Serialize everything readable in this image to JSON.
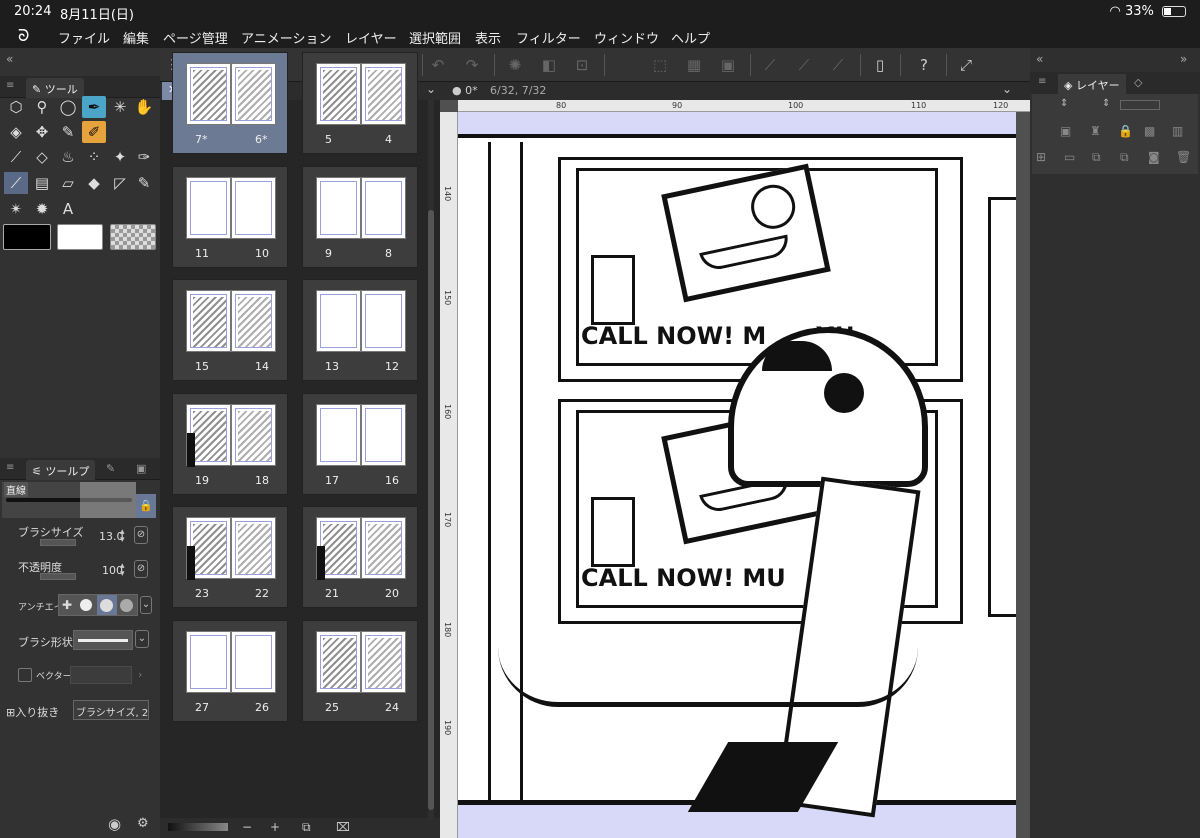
{
  "status": {
    "time": "20:24",
    "date": "8月11日(日)",
    "battery": "33%"
  },
  "menu": [
    "ファイル",
    "編集",
    "ページ管理",
    "アニメーション",
    "レイヤー",
    "選択範囲",
    "表示",
    "フィルター",
    "ウィンドウ",
    "ヘルプ"
  ],
  "toolbar": {
    "icons": [
      "menu-icon",
      "new-icon",
      "chevron-icon",
      "record-icon",
      "add-page-icon",
      "open-icon",
      "export-icon",
      "updown-icon",
      "undo-icon",
      "redo-icon",
      "loading-icon",
      "fill-icon",
      "transform-icon",
      "deselect-icon",
      "invert-icon",
      "border-icon",
      "pen-ruler-icon",
      "brush-ruler-icon",
      "line-ruler-icon",
      "device-icon",
      "help-icon",
      "resize-icon"
    ]
  },
  "tools_panel": {
    "tab_label": "ツール"
  },
  "tool_property": {
    "tab_label": "ツールプ",
    "preset_name": "直線",
    "brush_size_label": "ブラシサイズ",
    "brush_size_value": "13.0",
    "opacity_label": "不透明度",
    "opacity_value": "100",
    "antialias_label": "アンチエイ",
    "brush_shape_label": "ブラシ形状",
    "vector_label": "ベクター",
    "taper_label": "入り抜き",
    "taper_value": "ブラシサイズ, 2"
  },
  "pages": {
    "tab_label": "0",
    "rows": [
      {
        "left": "7*",
        "right": "6*",
        "active": true
      },
      {
        "left": "5",
        "right": "4"
      },
      {
        "left": "11",
        "right": "10"
      },
      {
        "left": "9",
        "right": "8"
      },
      {
        "left": "15",
        "right": "14"
      },
      {
        "left": "13",
        "right": "12"
      },
      {
        "left": "19",
        "right": "18"
      },
      {
        "left": "17",
        "right": "16"
      },
      {
        "left": "23",
        "right": "22"
      },
      {
        "left": "21",
        "right": "20"
      },
      {
        "left": "27",
        "right": "26"
      },
      {
        "left": "25",
        "right": "24"
      }
    ]
  },
  "canvas": {
    "tab_label": "0*",
    "page_info": "6/32, 7/32",
    "ruler_top": [
      "80",
      "90",
      "100",
      "110",
      "120"
    ],
    "ruler_left": [
      "140",
      "150",
      "160",
      "170",
      "180",
      "190"
    ],
    "comic_text_top": "CALL NOW! M      Y!!",
    "comic_text_bottom": "CALL NOW! MU      T!!"
  },
  "layers": {
    "tab_label": "レイヤー"
  }
}
